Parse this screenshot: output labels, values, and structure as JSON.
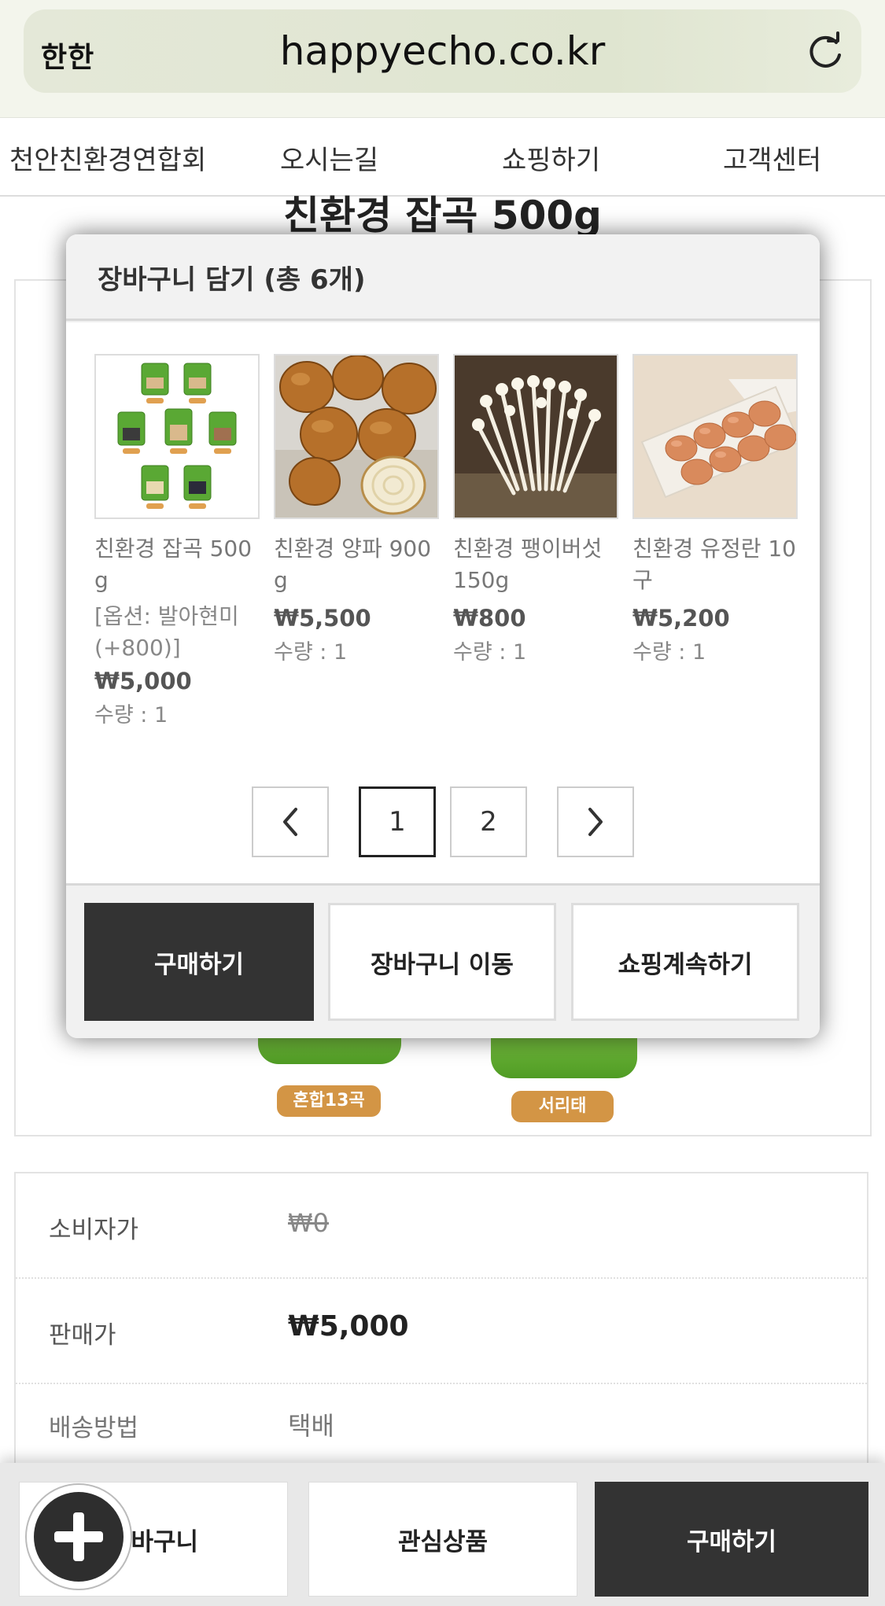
{
  "browser": {
    "aa_label": "한한",
    "url": "happyecho.co.kr",
    "reload_icon": "reload-icon"
  },
  "nav": {
    "items": [
      {
        "label": "천안친환경연합회"
      },
      {
        "label": "오시는길"
      },
      {
        "label": "쇼핑하기"
      },
      {
        "label": "고객센터"
      }
    ]
  },
  "product": {
    "title": "친환경 잡곡 500g",
    "bag_labels": [
      "혼합13곡",
      "서리태"
    ]
  },
  "info": {
    "rows": [
      {
        "label": "소비자가",
        "value": "₩0"
      },
      {
        "label": "판매가",
        "value": "₩5,000"
      },
      {
        "label": "배송방법",
        "value": "택배"
      }
    ]
  },
  "modal": {
    "title": "장바구니 담기 (총 6개)",
    "items": [
      {
        "name": "친환경 잡곡 500g",
        "option": "[옵션: 발아현미(+800)]",
        "price": "₩5,000",
        "qty": "수량 : 1",
        "image": "grain-bags-image"
      },
      {
        "name": "친환경 양파 900g",
        "price": "₩5,500",
        "qty": "수량 : 1",
        "image": "onion-image"
      },
      {
        "name": "친환경 팽이버섯 150g",
        "price": "₩800",
        "qty": "수량 : 1",
        "image": "enoki-mushroom-image"
      },
      {
        "name": "친환경 유정란 10구",
        "price": "₩5,200",
        "qty": "수량 : 1",
        "image": "egg-tray-image"
      }
    ],
    "pagination": {
      "prev_icon": "chevron-left-icon",
      "next_icon": "chevron-right-icon",
      "pages": [
        "1",
        "2"
      ],
      "current": "1"
    },
    "buttons": {
      "buy": "구매하기",
      "go_cart": "장바구니 이동",
      "continue": "쇼핑계속하기"
    }
  },
  "bottom_bar": {
    "cart": "장바구니",
    "wishlist": "관심상품",
    "buy": "구매하기",
    "fab_icon": "plus-icon"
  }
}
